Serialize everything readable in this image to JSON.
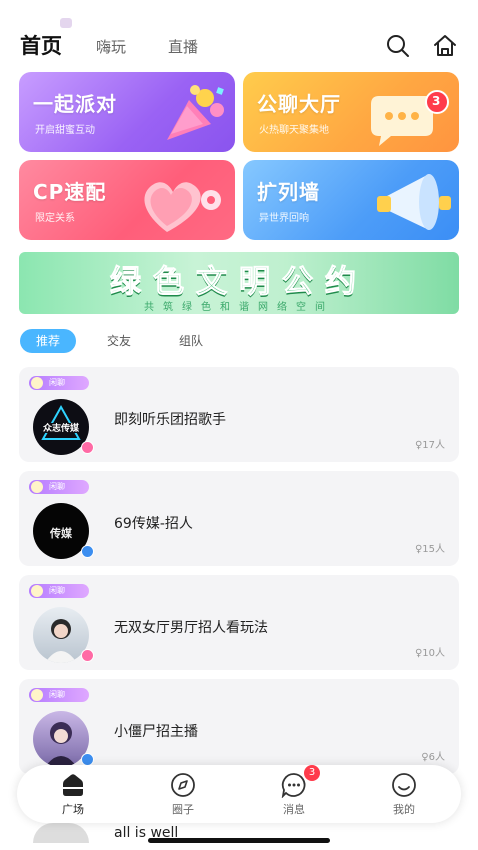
{
  "header": {
    "tabs": [
      {
        "label": "首页",
        "active": true
      },
      {
        "label": "嗨玩",
        "active": false
      },
      {
        "label": "直播",
        "active": false
      }
    ],
    "icons": [
      "search-icon",
      "home-icon"
    ]
  },
  "cards": [
    {
      "title": "一起派对",
      "subtitle": "开启甜蜜互动",
      "color": "#9a62f4"
    },
    {
      "title": "公聊大厅",
      "subtitle": "火热聊天聚集地",
      "color": "#ffa742",
      "badge": "3"
    },
    {
      "title": "CP速配",
      "subtitle": "限定关系",
      "color": "#ff5e7a"
    },
    {
      "title": "扩列墙",
      "subtitle": "异世界回响",
      "color": "#4d9df8"
    }
  ],
  "banner": {
    "title": "绿色文明公约",
    "subtitle": "共筑绿色和谐网络空间"
  },
  "filters": [
    {
      "label": "推荐",
      "active": true
    },
    {
      "label": "交友",
      "active": false
    },
    {
      "label": "组队",
      "active": false
    }
  ],
  "rooms": [
    {
      "tag": "闲聊",
      "name": "即刻听乐团招歌手",
      "count": "17人",
      "gender": "female",
      "avatar_text": "众志传媒"
    },
    {
      "tag": "闲聊",
      "name": "69传媒-招人",
      "count": "15人",
      "gender": "male",
      "avatar_text": "传媒"
    },
    {
      "tag": "闲聊",
      "name": "无双女厅男厅招人看玩法",
      "count": "10人",
      "gender": "female",
      "avatar_text": ""
    },
    {
      "tag": "闲聊",
      "name": "小僵尸招主播",
      "count": "6人",
      "gender": "male",
      "avatar_text": ""
    }
  ],
  "peek_room": {
    "name": "all  is  well"
  },
  "tabbar": {
    "items": [
      {
        "label": "广场",
        "icon": "home-filled-icon"
      },
      {
        "label": "圈子",
        "icon": "compass-icon"
      },
      {
        "label": "消息",
        "icon": "chat-icon",
        "badge": "3"
      },
      {
        "label": "我的",
        "icon": "smile-face-icon"
      }
    ]
  },
  "colors": {
    "accent": "#4ab6ff",
    "badge_red": "#ff3b4b",
    "banner_green": "#3dbb72"
  }
}
